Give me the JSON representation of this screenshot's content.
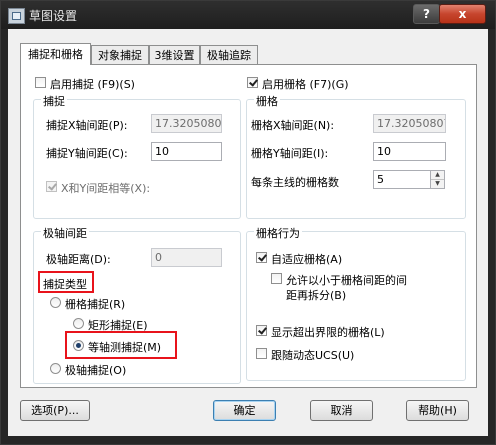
{
  "window": {
    "title": "草图设置",
    "help_label": "?",
    "close_label": "x"
  },
  "tabs": [
    {
      "label": "捕捉和栅格"
    },
    {
      "label": "对象捕捉"
    },
    {
      "label": "3维设置"
    },
    {
      "label": "极轴追踪"
    }
  ],
  "snap": {
    "enable_label": "启用捕捉 (F9)(S)",
    "enabled": false,
    "group_title": "捕捉",
    "x_spacing_label": "捕捉X轴间距(P):",
    "x_spacing_value": "17.32050807",
    "y_spacing_label": "捕捉Y轴间距(C):",
    "y_spacing_value": "10",
    "equal_label": "X和Y间距相等(X):",
    "equal_checked": true
  },
  "polar": {
    "group_title": "极轴间距",
    "distance_label": "极轴距离(D):",
    "distance_value": "0"
  },
  "snap_type": {
    "group_title": "捕捉类型",
    "grid_snap_label": "栅格捕捉(R)",
    "rect_snap_label": "矩形捕捉(E)",
    "iso_snap_label": "等轴测捕捉(M)",
    "polar_snap_label": "极轴捕捉(O)",
    "selected": "iso"
  },
  "grid": {
    "enable_label": "启用栅格 (F7)(G)",
    "enabled": true,
    "group_title": "栅格",
    "x_spacing_label": "栅格X轴间距(N):",
    "x_spacing_value": "17.32050807",
    "y_spacing_label": "栅格Y轴间距(I):",
    "y_spacing_value": "10",
    "major_label": "每条主线的栅格数",
    "major_value": "5"
  },
  "grid_behavior": {
    "group_title": "栅格行为",
    "adaptive_label": "自适应栅格(A)",
    "adaptive_checked": true,
    "subdivide_line1": "允许以小于栅格间距的间",
    "subdivide_line2": "距再拆分(B)",
    "subdivide_checked": false,
    "beyond_limits_label": "显示超出界限的栅格(L)",
    "beyond_limits_checked": true,
    "follow_ucs_label": "跟随动态UCS(U)",
    "follow_ucs_checked": false
  },
  "buttons": {
    "options": "选项(P)...",
    "ok": "确定",
    "cancel": "取消",
    "help": "帮助(H)"
  },
  "colors": {
    "highlight": "#e8131b",
    "titlebar": "#262626",
    "close": "#c6452d"
  }
}
